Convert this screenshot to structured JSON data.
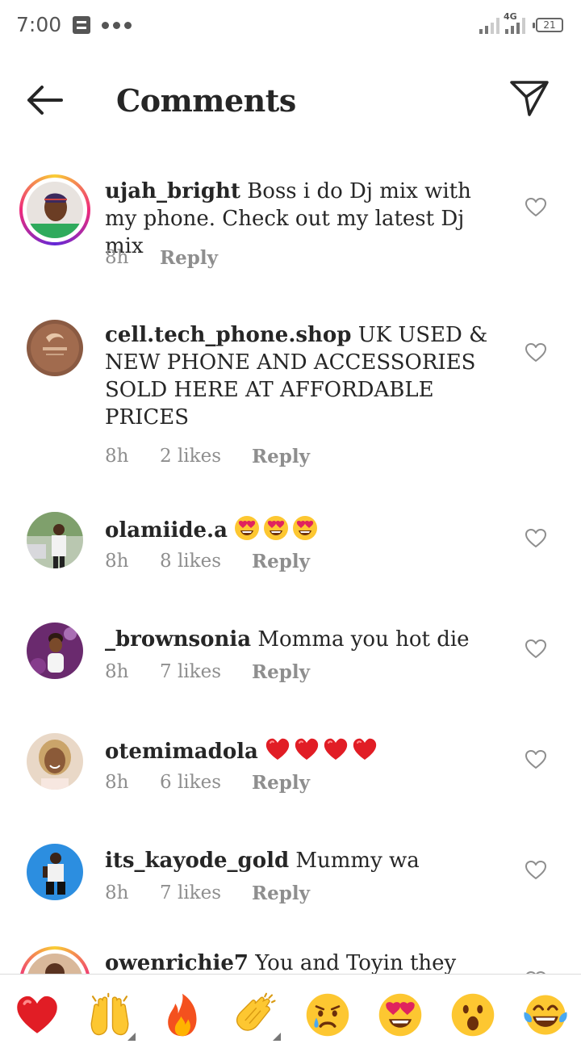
{
  "status_bar": {
    "time": "7:00",
    "network": "4G",
    "battery": "21",
    "icons": [
      "notification-icon",
      "more-dots-icon",
      "signal-icon",
      "signal-4g-icon",
      "battery-icon"
    ]
  },
  "header": {
    "title": "Comments",
    "back_icon": "arrow-left-icon",
    "share_icon": "paper-plane-icon"
  },
  "comments": [
    {
      "username": "ujah_bright",
      "text": "Boss i do Dj mix with my phone. Check out my latest Dj mix",
      "time": "8h",
      "likes": "",
      "reply_label": "Reply",
      "has_story_ring": true
    },
    {
      "username": "cell.tech_phone.shop",
      "text": "UK USED & NEW PHONE AND ACCESSORIES SOLD HERE AT AFFORDABLE PRICES",
      "time": "8h",
      "likes": "2 likes",
      "reply_label": "Reply",
      "has_story_ring": false
    },
    {
      "username": "olamiide.a",
      "text": "",
      "emojis": [
        "heart-eyes-emoji",
        "heart-eyes-emoji",
        "heart-eyes-emoji"
      ],
      "time": "8h",
      "likes": "8 likes",
      "reply_label": "Reply",
      "has_story_ring": false
    },
    {
      "username": "_brownsonia",
      "text": "Momma you hot die",
      "time": "8h",
      "likes": "7 likes",
      "reply_label": "Reply",
      "has_story_ring": false
    },
    {
      "username": "otemimadola",
      "text": "",
      "emojis": [
        "red-heart-emoji",
        "red-heart-emoji",
        "red-heart-emoji",
        "red-heart-emoji"
      ],
      "time": "8h",
      "likes": "6 likes",
      "reply_label": "Reply",
      "has_story_ring": false
    },
    {
      "username": "its_kayode_gold",
      "text": "Mummy wa",
      "time": "8h",
      "likes": "7 likes",
      "reply_label": "Reply",
      "has_story_ring": false
    },
    {
      "username": "owenrichie7",
      "text": "You and Toyin they",
      "time": "",
      "likes": "",
      "reply_label": "",
      "has_story_ring": true
    }
  ],
  "emoji_bar": [
    "red-heart-emoji",
    "raising-hands-emoji",
    "fire-emoji",
    "clapping-hands-emoji",
    "crying-face-emoji",
    "heart-eyes-emoji",
    "surprised-face-emoji",
    "tears-of-joy-emoji"
  ],
  "colors": {
    "text": "#262626",
    "secondary": "#8e8e8e",
    "heart_red": "#ed1c24",
    "emoji_yellow": "#fdc731"
  }
}
